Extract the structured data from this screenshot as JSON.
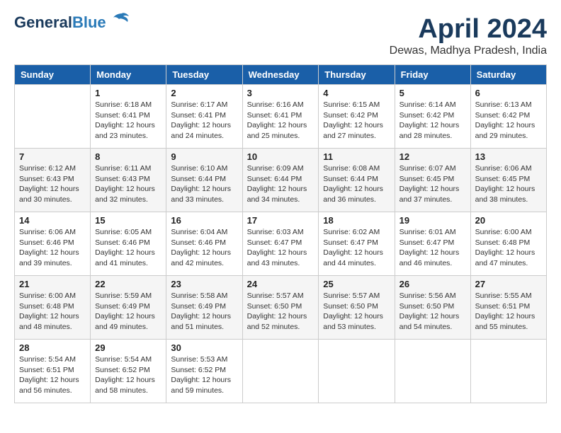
{
  "header": {
    "logo_line1": "General",
    "logo_line2": "Blue",
    "month_title": "April 2024",
    "subtitle": "Dewas, Madhya Pradesh, India"
  },
  "days_of_week": [
    "Sunday",
    "Monday",
    "Tuesday",
    "Wednesday",
    "Thursday",
    "Friday",
    "Saturday"
  ],
  "weeks": [
    [
      {
        "day": "",
        "sunrise": "",
        "sunset": "",
        "daylight": ""
      },
      {
        "day": "1",
        "sunrise": "Sunrise: 6:18 AM",
        "sunset": "Sunset: 6:41 PM",
        "daylight": "Daylight: 12 hours and 23 minutes."
      },
      {
        "day": "2",
        "sunrise": "Sunrise: 6:17 AM",
        "sunset": "Sunset: 6:41 PM",
        "daylight": "Daylight: 12 hours and 24 minutes."
      },
      {
        "day": "3",
        "sunrise": "Sunrise: 6:16 AM",
        "sunset": "Sunset: 6:41 PM",
        "daylight": "Daylight: 12 hours and 25 minutes."
      },
      {
        "day": "4",
        "sunrise": "Sunrise: 6:15 AM",
        "sunset": "Sunset: 6:42 PM",
        "daylight": "Daylight: 12 hours and 27 minutes."
      },
      {
        "day": "5",
        "sunrise": "Sunrise: 6:14 AM",
        "sunset": "Sunset: 6:42 PM",
        "daylight": "Daylight: 12 hours and 28 minutes."
      },
      {
        "day": "6",
        "sunrise": "Sunrise: 6:13 AM",
        "sunset": "Sunset: 6:42 PM",
        "daylight": "Daylight: 12 hours and 29 minutes."
      }
    ],
    [
      {
        "day": "7",
        "sunrise": "Sunrise: 6:12 AM",
        "sunset": "Sunset: 6:43 PM",
        "daylight": "Daylight: 12 hours and 30 minutes."
      },
      {
        "day": "8",
        "sunrise": "Sunrise: 6:11 AM",
        "sunset": "Sunset: 6:43 PM",
        "daylight": "Daylight: 12 hours and 32 minutes."
      },
      {
        "day": "9",
        "sunrise": "Sunrise: 6:10 AM",
        "sunset": "Sunset: 6:44 PM",
        "daylight": "Daylight: 12 hours and 33 minutes."
      },
      {
        "day": "10",
        "sunrise": "Sunrise: 6:09 AM",
        "sunset": "Sunset: 6:44 PM",
        "daylight": "Daylight: 12 hours and 34 minutes."
      },
      {
        "day": "11",
        "sunrise": "Sunrise: 6:08 AM",
        "sunset": "Sunset: 6:44 PM",
        "daylight": "Daylight: 12 hours and 36 minutes."
      },
      {
        "day": "12",
        "sunrise": "Sunrise: 6:07 AM",
        "sunset": "Sunset: 6:45 PM",
        "daylight": "Daylight: 12 hours and 37 minutes."
      },
      {
        "day": "13",
        "sunrise": "Sunrise: 6:06 AM",
        "sunset": "Sunset: 6:45 PM",
        "daylight": "Daylight: 12 hours and 38 minutes."
      }
    ],
    [
      {
        "day": "14",
        "sunrise": "Sunrise: 6:06 AM",
        "sunset": "Sunset: 6:46 PM",
        "daylight": "Daylight: 12 hours and 39 minutes."
      },
      {
        "day": "15",
        "sunrise": "Sunrise: 6:05 AM",
        "sunset": "Sunset: 6:46 PM",
        "daylight": "Daylight: 12 hours and 41 minutes."
      },
      {
        "day": "16",
        "sunrise": "Sunrise: 6:04 AM",
        "sunset": "Sunset: 6:46 PM",
        "daylight": "Daylight: 12 hours and 42 minutes."
      },
      {
        "day": "17",
        "sunrise": "Sunrise: 6:03 AM",
        "sunset": "Sunset: 6:47 PM",
        "daylight": "Daylight: 12 hours and 43 minutes."
      },
      {
        "day": "18",
        "sunrise": "Sunrise: 6:02 AM",
        "sunset": "Sunset: 6:47 PM",
        "daylight": "Daylight: 12 hours and 44 minutes."
      },
      {
        "day": "19",
        "sunrise": "Sunrise: 6:01 AM",
        "sunset": "Sunset: 6:47 PM",
        "daylight": "Daylight: 12 hours and 46 minutes."
      },
      {
        "day": "20",
        "sunrise": "Sunrise: 6:00 AM",
        "sunset": "Sunset: 6:48 PM",
        "daylight": "Daylight: 12 hours and 47 minutes."
      }
    ],
    [
      {
        "day": "21",
        "sunrise": "Sunrise: 6:00 AM",
        "sunset": "Sunset: 6:48 PM",
        "daylight": "Daylight: 12 hours and 48 minutes."
      },
      {
        "day": "22",
        "sunrise": "Sunrise: 5:59 AM",
        "sunset": "Sunset: 6:49 PM",
        "daylight": "Daylight: 12 hours and 49 minutes."
      },
      {
        "day": "23",
        "sunrise": "Sunrise: 5:58 AM",
        "sunset": "Sunset: 6:49 PM",
        "daylight": "Daylight: 12 hours and 51 minutes."
      },
      {
        "day": "24",
        "sunrise": "Sunrise: 5:57 AM",
        "sunset": "Sunset: 6:50 PM",
        "daylight": "Daylight: 12 hours and 52 minutes."
      },
      {
        "day": "25",
        "sunrise": "Sunrise: 5:57 AM",
        "sunset": "Sunset: 6:50 PM",
        "daylight": "Daylight: 12 hours and 53 minutes."
      },
      {
        "day": "26",
        "sunrise": "Sunrise: 5:56 AM",
        "sunset": "Sunset: 6:50 PM",
        "daylight": "Daylight: 12 hours and 54 minutes."
      },
      {
        "day": "27",
        "sunrise": "Sunrise: 5:55 AM",
        "sunset": "Sunset: 6:51 PM",
        "daylight": "Daylight: 12 hours and 55 minutes."
      }
    ],
    [
      {
        "day": "28",
        "sunrise": "Sunrise: 5:54 AM",
        "sunset": "Sunset: 6:51 PM",
        "daylight": "Daylight: 12 hours and 56 minutes."
      },
      {
        "day": "29",
        "sunrise": "Sunrise: 5:54 AM",
        "sunset": "Sunset: 6:52 PM",
        "daylight": "Daylight: 12 hours and 58 minutes."
      },
      {
        "day": "30",
        "sunrise": "Sunrise: 5:53 AM",
        "sunset": "Sunset: 6:52 PM",
        "daylight": "Daylight: 12 hours and 59 minutes."
      },
      {
        "day": "",
        "sunrise": "",
        "sunset": "",
        "daylight": ""
      },
      {
        "day": "",
        "sunrise": "",
        "sunset": "",
        "daylight": ""
      },
      {
        "day": "",
        "sunrise": "",
        "sunset": "",
        "daylight": ""
      },
      {
        "day": "",
        "sunrise": "",
        "sunset": "",
        "daylight": ""
      }
    ]
  ]
}
